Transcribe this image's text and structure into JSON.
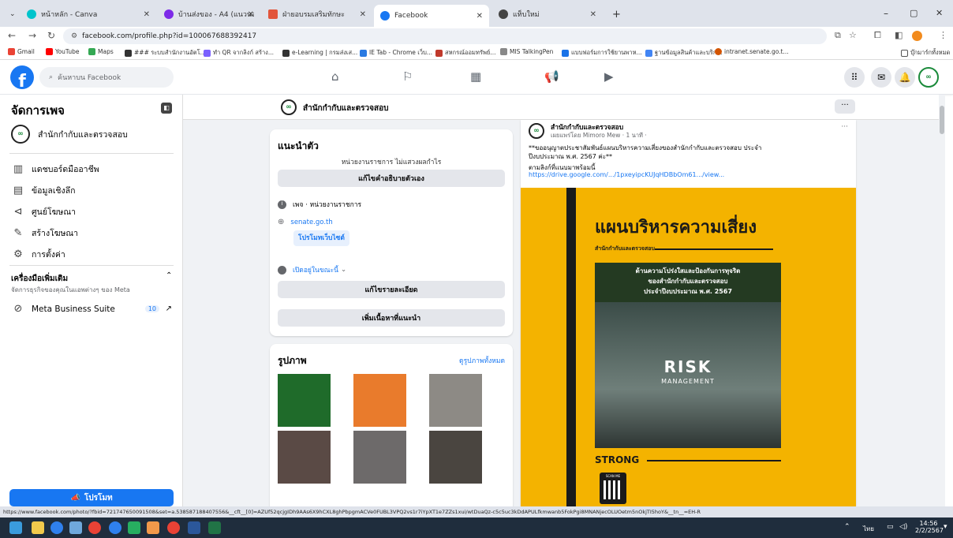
{
  "browser": {
    "tabs": [
      {
        "title": "หน้าหลัก - Canva",
        "color": "#00c4cc"
      },
      {
        "title": "บ้านส่งของ - A4 (แนวนอน)",
        "color": "#7d2ae8"
      },
      {
        "title": "ฝ่ายอบรมเสริมทักษะ",
        "color": "#e2553b"
      },
      {
        "title": "Facebook",
        "color": "#1877f2"
      },
      {
        "title": "แท็บใหม่",
        "color": "#444444"
      }
    ],
    "new_tab": "+",
    "minimize": "–",
    "restore": "▢",
    "close": "✕",
    "url": "facebook.com/profile.php?id=100067688392417",
    "bookmarks": [
      {
        "label": "Gmail",
        "color": "#ea4335"
      },
      {
        "label": "YouTube",
        "color": "#ff0000"
      },
      {
        "label": "Maps",
        "color": "#34a853"
      },
      {
        "label": "### ระบบสำนักงานอัตโ...",
        "color": "#333333"
      },
      {
        "label": "ทำ QR จากลิงก์ สร้าง...",
        "color": "#7b61ff"
      },
      {
        "label": "e-Learning | กรมส่งเส...",
        "color": "#333333"
      },
      {
        "label": "IE Tab - Chrome เว็บ...",
        "color": "#2a7ae2"
      },
      {
        "label": "สหกรณ์ออมทรัพย์...",
        "color": "#c0392b"
      },
      {
        "label": "MIS TalkingPen",
        "color": "#888888"
      },
      {
        "label": "แบบฟอร์มการใช้ยานพาห...",
        "color": "#1a73e8"
      },
      {
        "label": "ฐานข้อมูลสินค้าและบริก...",
        "color": "#4285f4"
      },
      {
        "label": "intranet.senate.go.t...",
        "color": "#d35400"
      }
    ],
    "bookmarks_folder": "บุ๊กมาร์กทั้งหมด"
  },
  "fb": {
    "search_placeholder": "ค้นหาบน Facebook",
    "logo": "f"
  },
  "sidebar": {
    "title": "จัดการเพจ",
    "page_name": "สำนักกำกับและตรวจสอบ",
    "items": [
      {
        "label": "แดชบอร์ดมืออาชีพ",
        "icon": "dashboard-icon"
      },
      {
        "label": "ข้อมูลเชิงลึก",
        "icon": "insights-icon"
      },
      {
        "label": "ศูนย์โฆษณา",
        "icon": "megaphone-icon"
      },
      {
        "label": "สร้างโฆษณา",
        "icon": "pencil-icon"
      },
      {
        "label": "การตั้งค่า",
        "icon": "gear-icon"
      }
    ],
    "tools_title": "เครื่องมือเพิ่มเติม",
    "tools_sub": "จัดการธุรกิจของคุณในแอพต่างๆ ของ Meta",
    "mbs_label": "Meta Business Suite",
    "mbs_count": "10",
    "promote": "โปรโมท"
  },
  "page": {
    "name": "สำนักกำกับและตรวจสอบ",
    "more": "···",
    "intro": {
      "title": "แนะนำตัว",
      "desc": "หน่วยงานราชการ ไม่แสวงผลกำไร",
      "edit_bio": "แก้ไขคำอธิบายตัวเอง",
      "category": "เพจ · หน่วยงานราชการ",
      "website": "senate.go.th",
      "promote_site": "โปรโมทเว็บไซต์",
      "open_now": "เปิดอยู่ในขณะนี้",
      "edit_details": "แก้ไขรายละเอียด",
      "add_featured": "เพิ่มเนื้อหาที่แนะนำ"
    },
    "photos": {
      "title": "รูปภาพ",
      "see_all": "ดูรูปภาพทั้งหมด"
    },
    "post": {
      "author": "สำนักกำกับและตรวจสอบ",
      "meta": "เผยแพร่โดย Mimoro Mew · 1 นาที ·",
      "text": "**ขออนุญาตประชาสัมพันธ์แผนบริหารความเสี่ยงของสำนักกำกับและตรวจสอบ ประจำปีงบประมาณ พ.ศ. 2567 ค่ะ**",
      "link_label": "ตามลิงก์ที่แนบมาพร้อมนี้",
      "link": "https://drive.google.com/.../1pxeyipcKUJqHDBbOm61.../view...",
      "more": "···"
    },
    "poster": {
      "title": "แผนบริหารความเสี่ยง",
      "org": "สำนักกำกับและตรวจสอบ",
      "box_line1": "ด้านความโปร่งใสและป้องกันการทุจริต",
      "box_line2": "ของสำนักกำกับและตรวจสอบ",
      "box_line3": "ประจำปีงบประมาณ พ.ศ. 2567",
      "risk": "RISK",
      "management": "MANAGEMENT",
      "strong": "STRONG",
      "scan": "SCAN ME"
    }
  },
  "status_url": "https://www.facebook.com/photo/?fbid=721747650091508&set=a.538587188407556&__cft__[0]=AZUf52qcjgIDh9AAs6X9hCXL8ghPbpgmACVe0FUBL3VPQ2vs1r7iYpXT1e7ZZs1xui/wtDuaQz-c5c5uc3kDdAPULfkmwanb5FokPgi8MNANjecOLUOetm5nOkjTI5hoY&__tn__=EH-R",
  "taskbar": {
    "lang": "ไทย",
    "time": "14:56",
    "date": "2/2/2567"
  }
}
